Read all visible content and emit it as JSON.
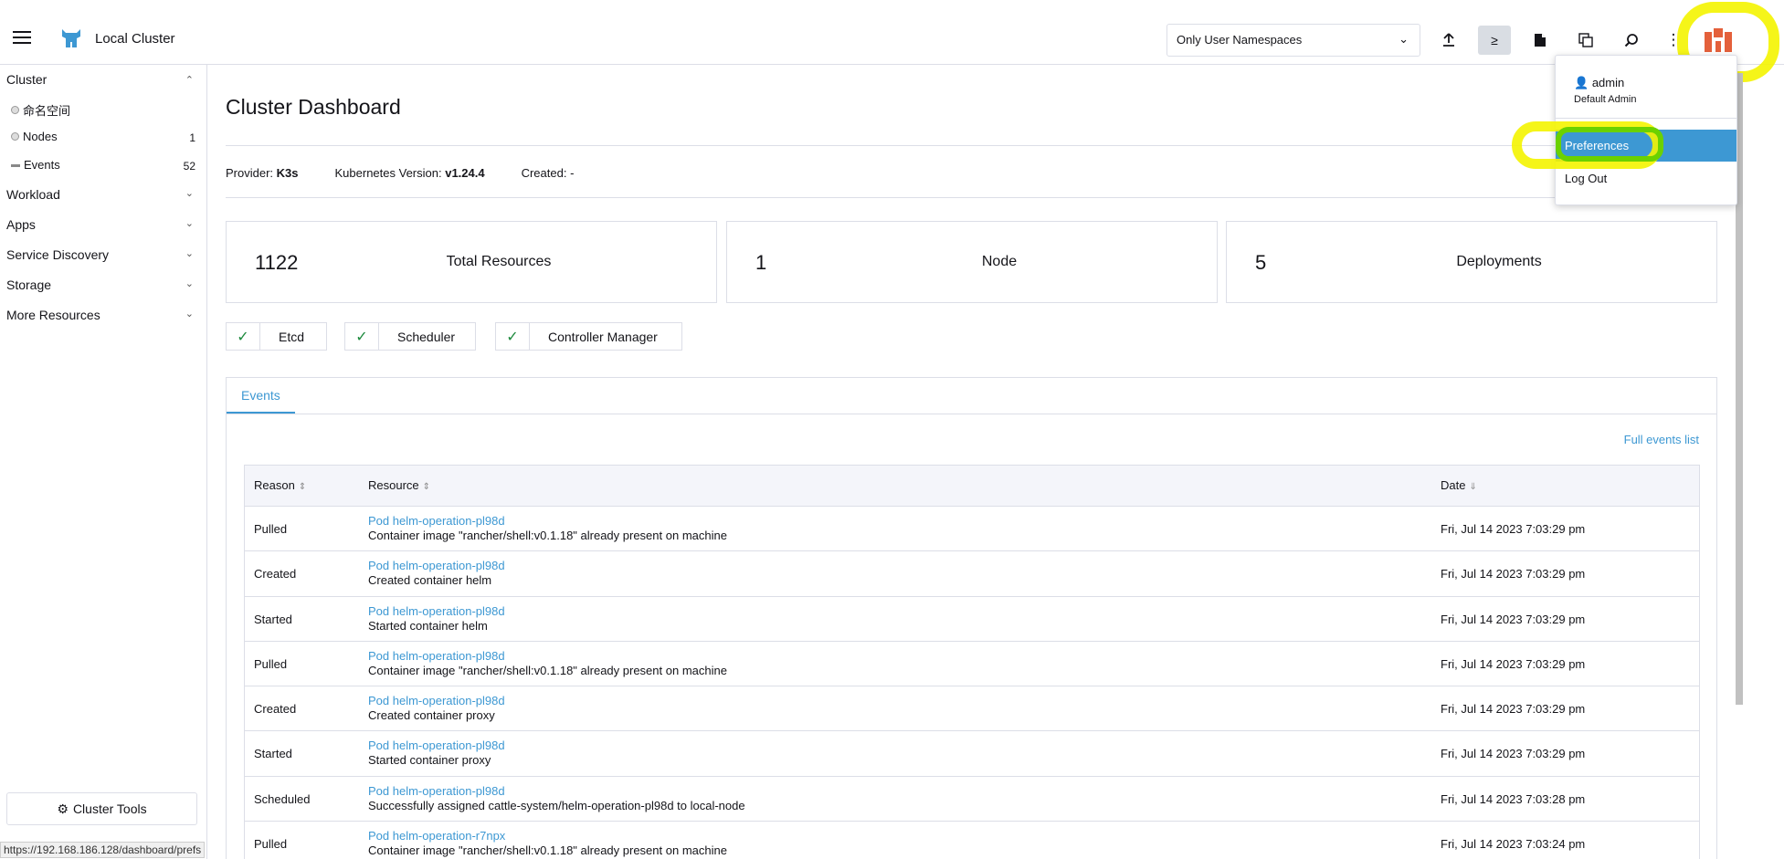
{
  "header": {
    "cluster_name": "Local Cluster",
    "namespace_filter": "Only User Namespaces"
  },
  "sidebar": {
    "groups": [
      {
        "label": "Cluster"
      },
      {
        "label": "Workload"
      },
      {
        "label": "Apps"
      },
      {
        "label": "Service Discovery"
      },
      {
        "label": "Storage"
      },
      {
        "label": "More Resources"
      }
    ],
    "cluster_items": [
      {
        "label": "命名空间",
        "count": ""
      },
      {
        "label": "Nodes",
        "count": "1"
      },
      {
        "label": "Events",
        "count": "52"
      }
    ],
    "tools_button": "Cluster Tools",
    "status_url": "https://192.168.186.128/dashboard/prefs"
  },
  "main": {
    "title": "Cluster Dashboard",
    "meta": {
      "provider_label": "Provider:",
      "provider_value": "K3s",
      "k8s_label": "Kubernetes Version:",
      "k8s_value": "v1.24.4",
      "created_label": "Created:",
      "created_value": "-"
    },
    "cards": [
      {
        "num": "1122",
        "label": "Total Resources"
      },
      {
        "num": "1",
        "label": "Node"
      },
      {
        "num": "5",
        "label": "Deployments"
      }
    ],
    "components": [
      "Etcd",
      "Scheduler",
      "Controller Manager"
    ],
    "events_tab": "Events",
    "full_events_link": "Full events list",
    "columns": {
      "reason": "Reason",
      "resource": "Resource",
      "date": "Date"
    },
    "rows": [
      {
        "reason": "Pulled",
        "link": "Pod helm-operation-pl98d",
        "msg": "Container image \"rancher/shell:v0.1.18\" already present on machine",
        "date": "Fri, Jul 14 2023  7:03:29 pm"
      },
      {
        "reason": "Created",
        "link": "Pod helm-operation-pl98d",
        "msg": "Created container helm",
        "date": "Fri, Jul 14 2023  7:03:29 pm"
      },
      {
        "reason": "Started",
        "link": "Pod helm-operation-pl98d",
        "msg": "Started container helm",
        "date": "Fri, Jul 14 2023  7:03:29 pm"
      },
      {
        "reason": "Pulled",
        "link": "Pod helm-operation-pl98d",
        "msg": "Container image \"rancher/shell:v0.1.18\" already present on machine",
        "date": "Fri, Jul 14 2023  7:03:29 pm"
      },
      {
        "reason": "Created",
        "link": "Pod helm-operation-pl98d",
        "msg": "Created container proxy",
        "date": "Fri, Jul 14 2023  7:03:29 pm"
      },
      {
        "reason": "Started",
        "link": "Pod helm-operation-pl98d",
        "msg": "Started container proxy",
        "date": "Fri, Jul 14 2023  7:03:29 pm"
      },
      {
        "reason": "Scheduled",
        "link": "Pod helm-operation-pl98d",
        "msg": "Successfully assigned cattle-system/helm-operation-pl98d to local-node",
        "date": "Fri, Jul 14 2023  7:03:28 pm"
      },
      {
        "reason": "Pulled",
        "link": "Pod helm-operation-r7npx",
        "msg": "Container image \"rancher/shell:v0.1.18\" already present on machine",
        "date": "Fri, Jul 14 2023  7:03:24 pm"
      }
    ]
  },
  "user_menu": {
    "username": "admin",
    "role": "Default Admin",
    "preferences": "Preferences",
    "logout": "Log Out"
  },
  "colors": {
    "accent": "#3d98d3",
    "highlight_yellow": "#f4f400",
    "highlight_green": "#6bd100"
  }
}
